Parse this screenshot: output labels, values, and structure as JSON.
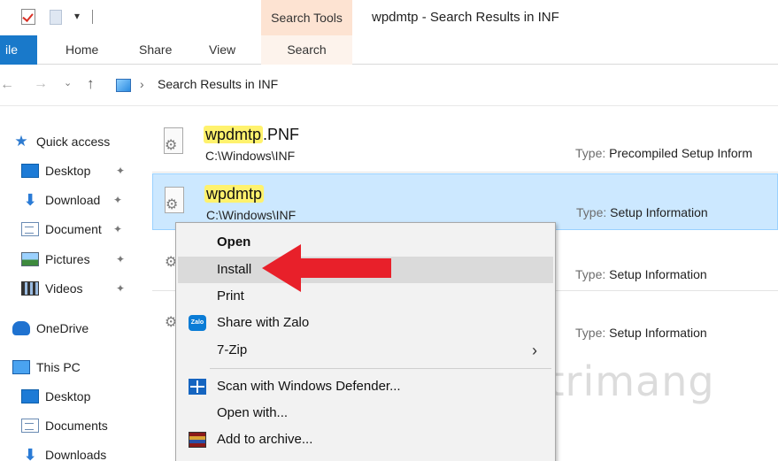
{
  "window": {
    "title": "wpdmtp - Search Results in INF",
    "context_tab": "Search Tools",
    "qat_dropdown": "▾"
  },
  "ribbon": {
    "tabs": [
      "ile",
      "Home",
      "Share",
      "View",
      "Search"
    ],
    "accent": "#1979ca",
    "context_color": "#fde3d2"
  },
  "address": {
    "path": "Search Results in INF"
  },
  "sidebar": {
    "items": [
      {
        "label": "Quick access",
        "icon": "star-icon"
      },
      {
        "label": "Desktop",
        "icon": "desktop-icon",
        "pinned": true
      },
      {
        "label": "Download",
        "icon": "download-icon",
        "pinned": true
      },
      {
        "label": "Document",
        "icon": "documents-icon",
        "pinned": true
      },
      {
        "label": "Pictures",
        "icon": "pictures-icon",
        "pinned": true
      },
      {
        "label": "Videos",
        "icon": "videos-icon",
        "pinned": true
      },
      {
        "label": "OneDrive",
        "icon": "cloud-icon"
      },
      {
        "label": "This PC",
        "icon": "computer-icon"
      },
      {
        "label": "Desktop",
        "icon": "desktop-icon"
      },
      {
        "label": "Documents",
        "icon": "documents-icon"
      },
      {
        "label": "Downloads",
        "icon": "download-icon"
      }
    ]
  },
  "files": [
    {
      "name_highlight": "wpdmtp",
      "name_rest": ".PNF",
      "path": "C:\\Windows\\INF",
      "type_key": "Type:",
      "type_value": "Precompiled Setup Inform"
    },
    {
      "name_highlight": "wpdmtp",
      "name_rest": "",
      "path": "C:\\Windows\\INF",
      "type_key": "Type:",
      "type_value": "Setup Information",
      "selected": true
    },
    {
      "type_key": "Type:",
      "type_value": "Setup Information"
    },
    {
      "type_key": "Type:",
      "type_value": "Setup Information"
    }
  ],
  "context_menu": {
    "items": [
      {
        "label": "Open",
        "bold": true
      },
      {
        "label": "Install",
        "hover": true
      },
      {
        "label": "Print"
      },
      {
        "label": "Share with Zalo",
        "icon": "zalo-icon",
        "icon_text": "Zalo"
      },
      {
        "label": "7-Zip",
        "submenu": "›"
      },
      {
        "label": "Scan with Windows Defender...",
        "icon": "windows-defender-icon"
      },
      {
        "label": "Open with..."
      },
      {
        "label": "Add to archive...",
        "icon": "winrar-icon"
      }
    ]
  },
  "watermark": {
    "text": "uantrimang"
  },
  "colors": {
    "selection": "#cce8ff",
    "highlight": "#fff26d",
    "arrow": "#e8202a"
  }
}
